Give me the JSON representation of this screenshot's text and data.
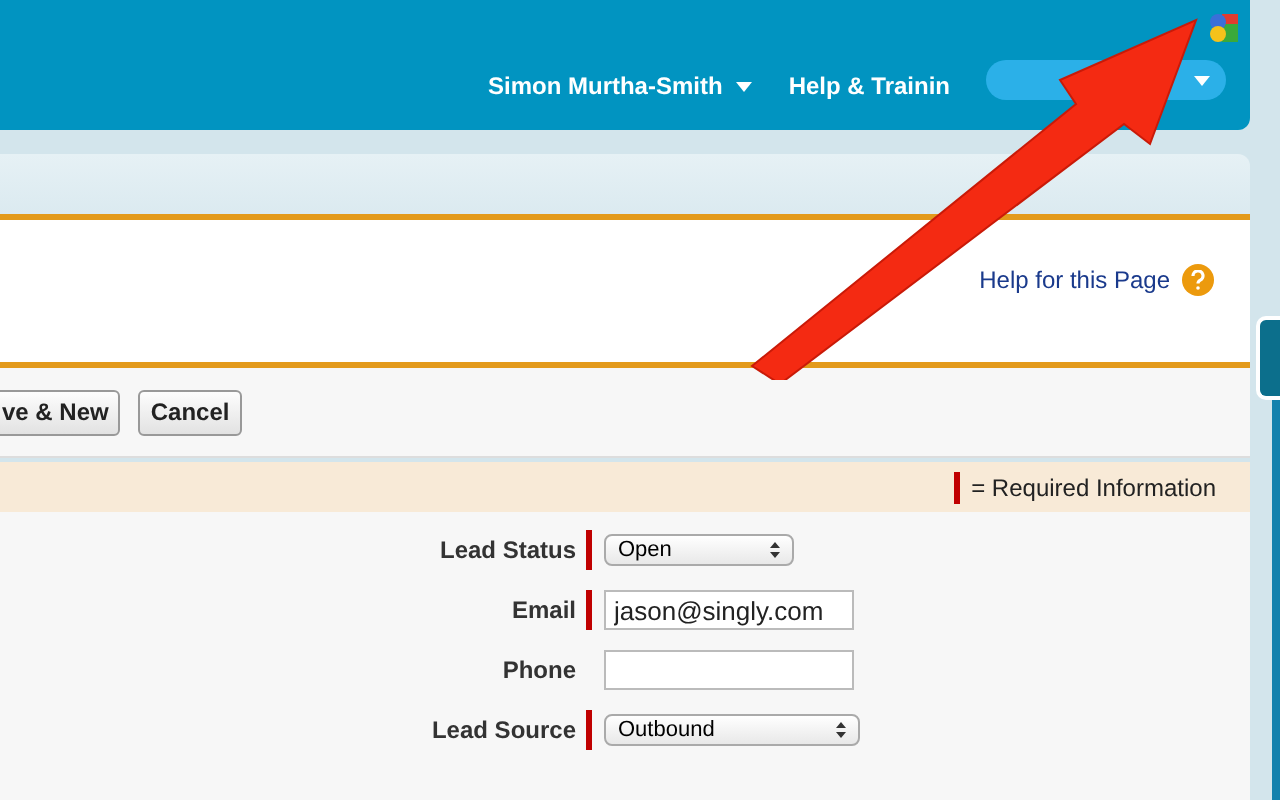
{
  "header": {
    "user_menu": "Simon Murtha-Smith",
    "help_menu": "Help & Trainin"
  },
  "help_link": "Help for this Page",
  "buttons": [
    "ve & New",
    "Cancel"
  ],
  "required_legend": "= Required Information",
  "fields": [
    {
      "label": "Lead Status",
      "kind": "select",
      "value": "Open",
      "required": true
    },
    {
      "label": "Email",
      "kind": "input",
      "value": "jason@singly.com",
      "required": true
    },
    {
      "label": "Phone",
      "kind": "input",
      "required": false
    },
    {
      "label": "Lead Source",
      "kind": "select",
      "value": "Outbound",
      "required": true
    }
  ]
}
